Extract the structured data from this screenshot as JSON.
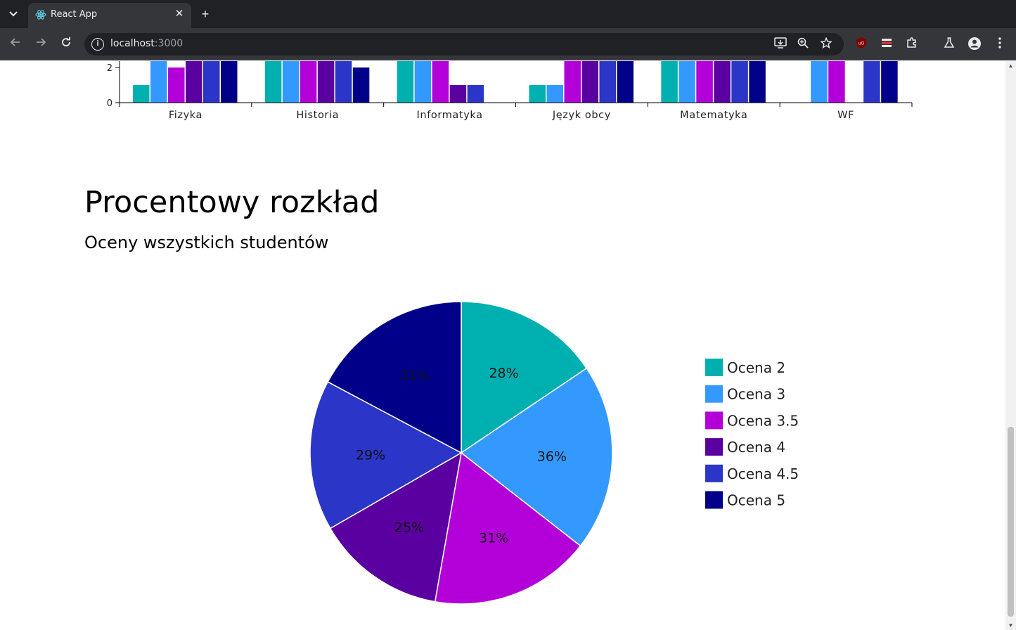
{
  "browser": {
    "tab_title": "React App",
    "url_host": "localhost",
    "url_port": ":3000",
    "icons": [
      "chevron-down-icon",
      "react-icon",
      "close-icon",
      "plus-icon",
      "back-icon",
      "forward-icon",
      "reload-icon",
      "info-icon",
      "install-icon",
      "zoom-icon",
      "star-icon",
      "ublock-icon",
      "extension-icon",
      "puzzle-icon",
      "labs-icon",
      "profile-icon",
      "menu-icon"
    ]
  },
  "bar_chart": {
    "y_ticks": [
      "0",
      "2"
    ],
    "categories": [
      "Fizyka",
      "Historia",
      "Informatyka",
      "Język obcy",
      "Matematyka",
      "WF"
    ],
    "colors": [
      "#00b0b0",
      "#3399ff",
      "#b300d9",
      "#5a00a0",
      "#2b35c8",
      "#000088"
    ]
  },
  "section": {
    "title": "Procentowy rozkład",
    "subtitle": "Oceny wszystkich studentów"
  },
  "chart_data": {
    "type": "pie",
    "labels": [
      "Ocena 2",
      "Ocena 3",
      "Ocena 3.5",
      "Ocena 4",
      "Ocena 4.5",
      "Ocena 5"
    ],
    "values": [
      28,
      36,
      31,
      25,
      29,
      31
    ],
    "slice_labels": [
      "28%",
      "36%",
      "31%",
      "25%",
      "29%",
      "31%"
    ],
    "colors": [
      "#00b0b0",
      "#3399ff",
      "#b300d9",
      "#5a00a0",
      "#2b35c8",
      "#000088"
    ],
    "legend": "right"
  }
}
